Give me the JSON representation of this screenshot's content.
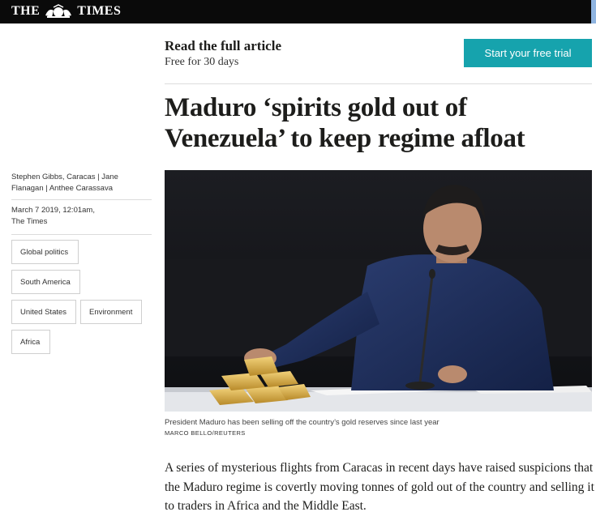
{
  "header": {
    "logo_text_left": "THE",
    "logo_text_right": "TIMES",
    "logo_icon": "royal-crest-icon",
    "bg_color": "#0a0a0a"
  },
  "promo": {
    "title": "Read the full article",
    "subtitle": "Free for 30 days",
    "cta_label": "Start your free trial",
    "cta_color": "#16a3ad"
  },
  "article": {
    "headline": "Maduro ‘spirits gold out of Venezuela’ to keep regime afloat",
    "byline": "Stephen Gibbs, Caracas | Jane Flanagan | Anthee Carassava",
    "date": "March 7 2019, 12:01am,",
    "publication": "The Times",
    "tags": [
      "Global politics",
      "South America",
      "United States",
      "Environment",
      "Africa"
    ],
    "image_caption": "President Maduro has been selling off the country’s gold reserves since last year",
    "image_credit": "MARCO BELLO/REUTERS",
    "lead_paragraph": "A series of mysterious flights from Caracas in recent days have raised suspicions that the Maduro regime is covertly moving tonnes of gold out of the country and selling it to traders in Africa and the Middle East."
  }
}
